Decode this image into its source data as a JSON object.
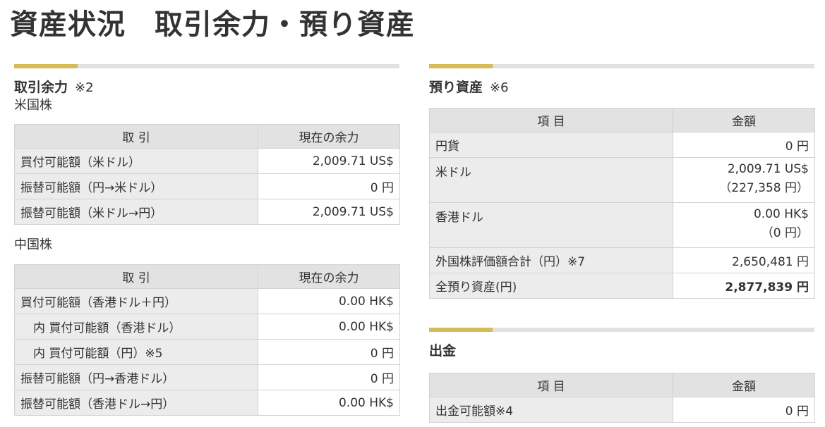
{
  "page_title": "資産状況　取引余力・預り資産",
  "trading_power": {
    "title": "取引余力",
    "note": "※2",
    "us": {
      "label": "米国株",
      "headers": [
        "取 引",
        "現在の余力"
      ],
      "rows": [
        {
          "label": "買付可能額（米ドル）",
          "value": "2,009.71 US$"
        },
        {
          "label": "振替可能額（円→米ドル）",
          "value": "0 円"
        },
        {
          "label": "振替可能額（米ドル→円）",
          "value": "2,009.71 US$"
        }
      ]
    },
    "cn": {
      "label": "中国株",
      "headers": [
        "取 引",
        "現在の余力"
      ],
      "rows": [
        {
          "label": "買付可能額（香港ドル＋円）",
          "value": "0.00 HK$"
        },
        {
          "label": "内 買付可能額（香港ドル）",
          "value": "0.00 HK$"
        },
        {
          "label": "内 買付可能額（円）※5",
          "value": "0 円"
        },
        {
          "label": "振替可能額（円→香港ドル）",
          "value": "0 円"
        },
        {
          "label": "振替可能額（香港ドル→円）",
          "value": "0.00 HK$"
        }
      ]
    }
  },
  "deposit_assets": {
    "title": "預り資産",
    "note": "※6",
    "headers": [
      "項 目",
      "金額"
    ],
    "rows": [
      {
        "label": "円貨",
        "value": "0 円"
      },
      {
        "label": "米ドル",
        "value": "2,009.71 US$",
        "value2": "（227,358 円）"
      },
      {
        "label": "香港ドル",
        "value": "0.00 HK$",
        "value2": "（0 円）"
      },
      {
        "label": "外国株評価額合計（円）※7",
        "value": "2,650,481 円"
      },
      {
        "label": "全預り資産(円)",
        "value": "2,877,839 円"
      }
    ]
  },
  "withdrawal": {
    "title": "出金",
    "headers": [
      "項 目",
      "金額"
    ],
    "rows": [
      {
        "label": "出金可能額※4",
        "value": "0 円"
      }
    ]
  },
  "colors": {
    "accent": "#d6bc57",
    "header_bg": "#e2e2e2",
    "label_bg": "#ececec",
    "border": "#d2d2d2",
    "text": "#333333"
  }
}
